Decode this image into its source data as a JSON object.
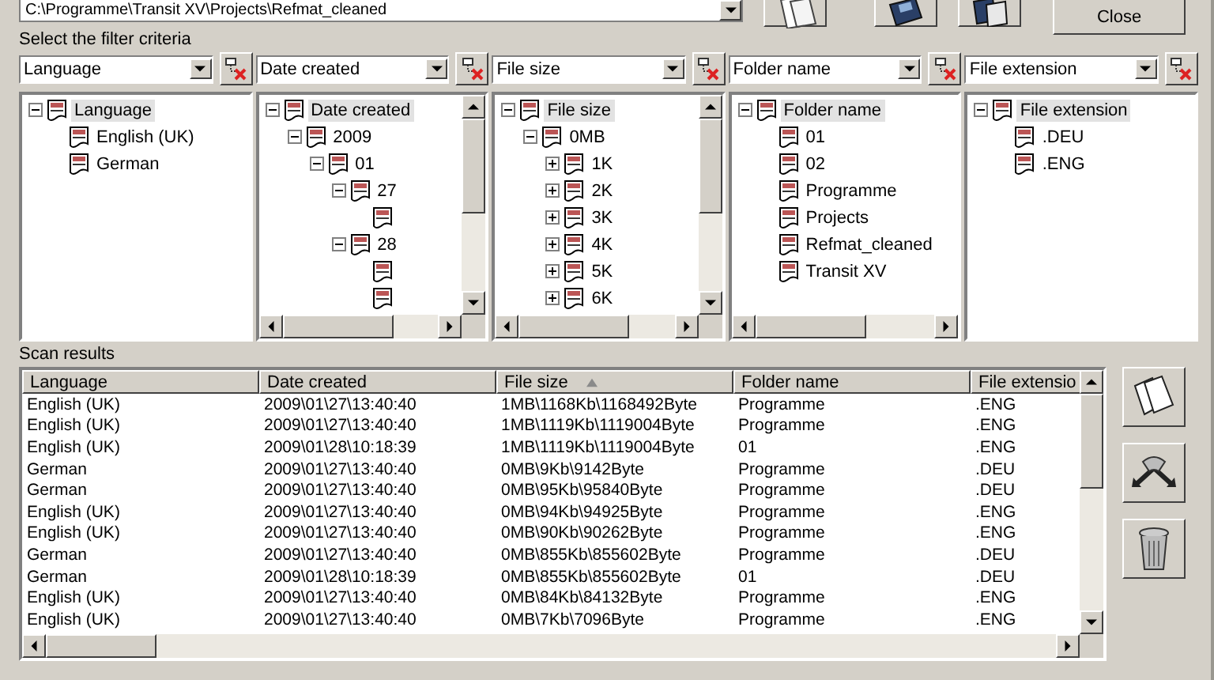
{
  "path_field": {
    "value": "C:\\Programme\\Transit XV\\Projects\\Refmat_cleaned"
  },
  "close_button": "Close",
  "filter_label": "Select the filter criteria",
  "filters": [
    {
      "value": "Language",
      "vertical_scrollbar": false,
      "horizontal_scrollbar": false,
      "tree": [
        {
          "label": "Language",
          "expanded": true,
          "selected": true,
          "children": [
            {
              "label": "English (UK)",
              "selected": false
            },
            {
              "label": "German",
              "selected": false
            }
          ]
        }
      ]
    },
    {
      "value": "Date created",
      "vertical_scrollbar": true,
      "horizontal_scrollbar": true,
      "tree": [
        {
          "label": "Date created",
          "expanded": true,
          "selected": true,
          "children": [
            {
              "label": "2009",
              "expanded": true,
              "selected": false,
              "children": [
                {
                  "label": "01",
                  "expanded": true,
                  "selected": false,
                  "children": [
                    {
                      "label": "27",
                      "expanded": true,
                      "selected": false,
                      "children": [
                        {
                          "selected": false
                        }
                      ]
                    },
                    {
                      "label": "28",
                      "expanded": true,
                      "selected": false,
                      "children": [
                        {
                          "selected": false
                        },
                        {
                          "selected": false
                        }
                      ]
                    }
                  ]
                }
              ]
            }
          ]
        }
      ]
    },
    {
      "value": "File size",
      "vertical_scrollbar": true,
      "horizontal_scrollbar": true,
      "tree": [
        {
          "label": "File size",
          "expanded": true,
          "selected": true,
          "children": [
            {
              "label": "0MB",
              "expanded": true,
              "selected": false,
              "children": [
                {
                  "label": "1K",
                  "expanded": false,
                  "selected": false
                },
                {
                  "label": "2K",
                  "expanded": false,
                  "selected": false
                },
                {
                  "label": "3K",
                  "expanded": false,
                  "selected": false
                },
                {
                  "label": "4K",
                  "expanded": false,
                  "selected": false
                },
                {
                  "label": "5K",
                  "expanded": false,
                  "selected": false
                },
                {
                  "label": "6K",
                  "expanded": false,
                  "selected": false
                }
              ]
            }
          ]
        }
      ]
    },
    {
      "value": "Folder name",
      "vertical_scrollbar": false,
      "horizontal_scrollbar": true,
      "tree": [
        {
          "label": "Folder name",
          "expanded": true,
          "selected": true,
          "children": [
            {
              "label": "01",
              "selected": false
            },
            {
              "label": "02",
              "selected": false
            },
            {
              "label": "Programme",
              "selected": false
            },
            {
              "label": "Projects",
              "selected": false
            },
            {
              "label": "Refmat_cleaned",
              "selected": false
            },
            {
              "label": "Transit XV",
              "selected": false
            }
          ]
        }
      ]
    },
    {
      "value": "File extension",
      "vertical_scrollbar": false,
      "horizontal_scrollbar": false,
      "tree": [
        {
          "label": "File extension",
          "expanded": true,
          "selected": true,
          "children": [
            {
              "label": ".DEU",
              "selected": false
            },
            {
              "label": ".ENG",
              "selected": false
            }
          ]
        }
      ]
    }
  ],
  "results_label": "Scan results",
  "table": {
    "columns": [
      {
        "label": "Language",
        "sorted": false
      },
      {
        "label": "Date created",
        "sorted": false
      },
      {
        "label": "File size",
        "sorted": true
      },
      {
        "label": "Folder name",
        "sorted": false
      },
      {
        "label": "File extensio",
        "sorted": false
      }
    ],
    "rows": [
      [
        "English (UK)",
        "2009\\01\\27\\13:40:40",
        "1MB\\1168Kb\\1168492Byte",
        "Programme",
        ".ENG"
      ],
      [
        "English (UK)",
        "2009\\01\\27\\13:40:40",
        "1MB\\1119Kb\\1119004Byte",
        "Programme",
        ".ENG"
      ],
      [
        "English (UK)",
        "2009\\01\\28\\10:18:39",
        "1MB\\1119Kb\\1119004Byte",
        "01",
        ".ENG"
      ],
      [
        "German",
        "2009\\01\\27\\13:40:40",
        "0MB\\9Kb\\9142Byte",
        "Programme",
        ".DEU"
      ],
      [
        "German",
        "2009\\01\\27\\13:40:40",
        "0MB\\95Kb\\95840Byte",
        "Programme",
        ".DEU"
      ],
      [
        "English (UK)",
        "2009\\01\\27\\13:40:40",
        "0MB\\94Kb\\94925Byte",
        "Programme",
        ".ENG"
      ],
      [
        "English (UK)",
        "2009\\01\\27\\13:40:40",
        "0MB\\90Kb\\90262Byte",
        "Programme",
        ".ENG"
      ],
      [
        "German",
        "2009\\01\\27\\13:40:40",
        "0MB\\855Kb\\855602Byte",
        "Programme",
        ".DEU"
      ],
      [
        "German",
        "2009\\01\\28\\10:18:39",
        "0MB\\855Kb\\855602Byte",
        "01",
        ".DEU"
      ],
      [
        "English (UK)",
        "2009\\01\\27\\13:40:40",
        "0MB\\84Kb\\84132Byte",
        "Programme",
        ".ENG"
      ],
      [
        "English (UK)",
        "2009\\01\\27\\13:40:40",
        "0MB\\7Kb\\7096Byte",
        "Programme",
        ".ENG"
      ]
    ]
  }
}
